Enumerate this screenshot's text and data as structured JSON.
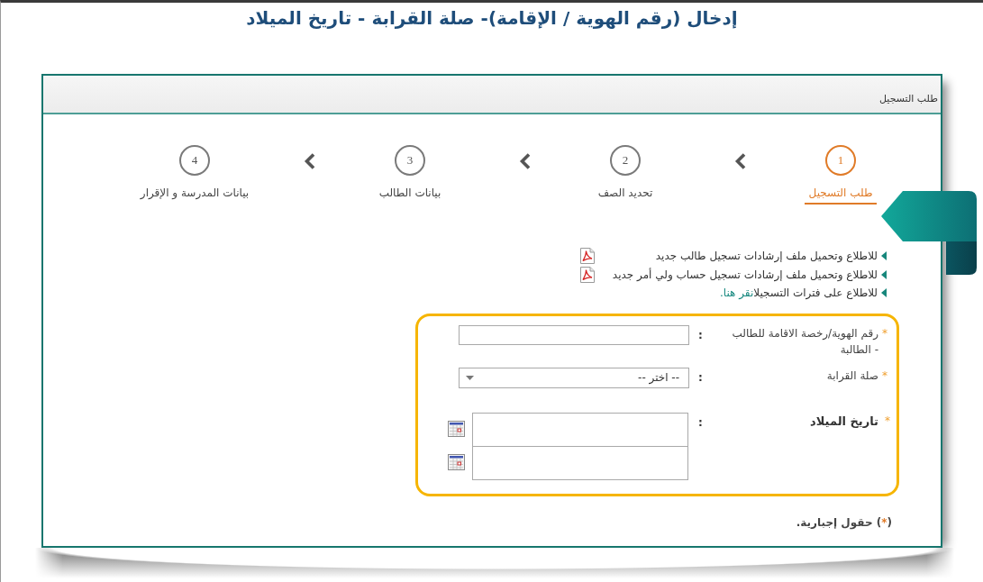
{
  "page_title": "إدخال (رقم الهوية / الإقامة)- صلة القرابة - تاريخ الميلاد",
  "panel": {
    "title": "طلب التسجيل",
    "steps": [
      {
        "number": "1",
        "label": "طلب التسجيل",
        "selected": true
      },
      {
        "number": "2",
        "label": "تحديد الصف",
        "selected": false
      },
      {
        "number": "3",
        "label": "بيانات الطالب",
        "selected": false
      },
      {
        "number": "4",
        "label": "بيانات المدرسة و الإقرار",
        "selected": false
      }
    ],
    "guide_lines": [
      {
        "kind": "download",
        "text": "للاطلاع وتحميل ملف إرشادات تسجيل طالب جديد"
      },
      {
        "kind": "download",
        "text": "للاطلاع وتحميل ملف إرشادات تسجيل حساب ولي أمر جديد"
      },
      {
        "kind": "link",
        "text": "للاطلاع على فترات التسجيل",
        "link": "انقر هنا."
      }
    ],
    "form": {
      "fields": [
        {
          "kind": "text",
          "required_mark": "*",
          "label": "رقم الهوية/رخصة الاقامة للطالب - الطالبة",
          "separator": ":"
        },
        {
          "kind": "select",
          "required_mark": "*",
          "label": "صلة القرابة",
          "separator": ":",
          "value": "-- اختر --"
        },
        {
          "kind": "date",
          "required_mark": "*",
          "label": "تاريخ الميلاد",
          "separator": ":",
          "inputs": [
            {
              "calendar_button": true
            },
            {
              "calendar_button": true
            }
          ]
        }
      ]
    },
    "required_note": {
      "prefix": "(",
      "marker": "*",
      "suffix": ") حقول إجبارية."
    }
  }
}
